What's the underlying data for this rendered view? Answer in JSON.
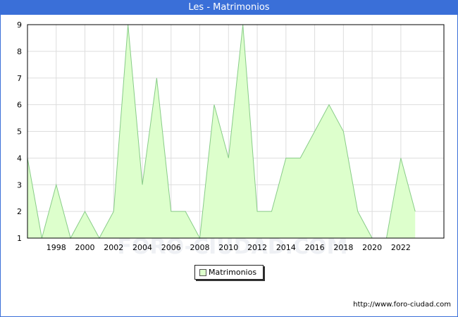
{
  "title": "Les - Matrimonios",
  "footer_url": "http://www.foro-ciudad.com",
  "watermark": "FORO-CIUDAD.COM",
  "colors": {
    "title_bar": "#3a6fd8",
    "area_fill": "#ddffcc",
    "line": "#88cc88",
    "grid": "#dddddd"
  },
  "chart_data": {
    "type": "area",
    "x": [
      1996,
      1997,
      1998,
      1999,
      2000,
      2001,
      2002,
      2003,
      2004,
      2005,
      2006,
      2007,
      2008,
      2009,
      2010,
      2011,
      2012,
      2013,
      2014,
      2015,
      2016,
      2017,
      2018,
      2019,
      2020,
      2021,
      2022,
      2023
    ],
    "series": [
      {
        "name": "Matrimonios",
        "values": [
          4,
          1,
          3,
          1,
          2,
          1,
          2,
          9,
          3,
          7,
          2,
          2,
          1,
          6,
          4,
          9,
          2,
          2,
          4,
          4,
          5,
          6,
          5,
          2,
          1,
          1,
          4,
          2
        ]
      }
    ],
    "x_ticks": [
      1998,
      2000,
      2002,
      2004,
      2006,
      2008,
      2010,
      2012,
      2014,
      2016,
      2018,
      2020,
      2022
    ],
    "y_ticks": [
      1,
      2,
      3,
      4,
      5,
      6,
      7,
      8,
      9
    ],
    "xlim": [
      1996,
      2025
    ],
    "ylim": [
      1,
      9
    ],
    "grid": true,
    "legend_position": "bottom-center"
  }
}
